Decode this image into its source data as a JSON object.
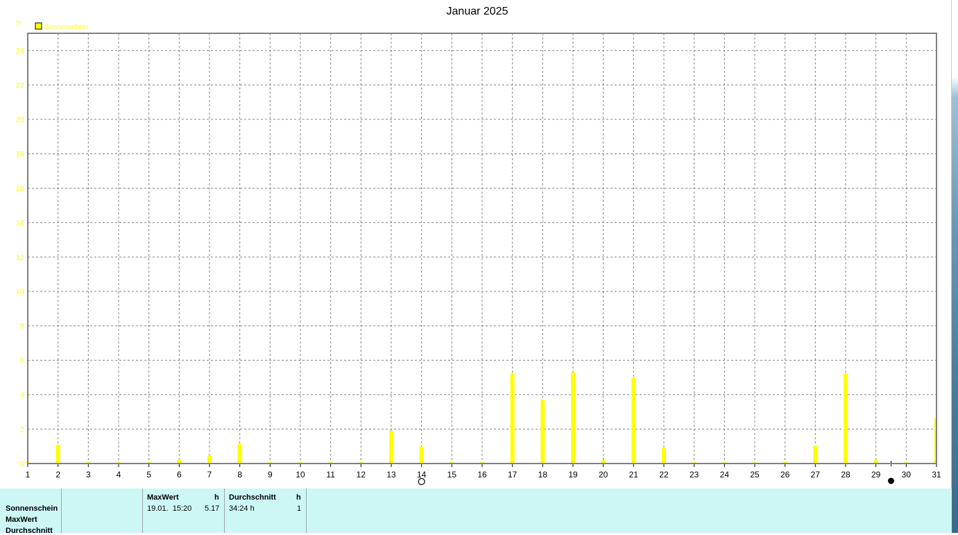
{
  "chart_data": {
    "type": "bar",
    "title": "Januar 2025",
    "ylabel": "h",
    "xlabel": "",
    "ylim": [
      0,
      25
    ],
    "yticks": [
      0,
      2,
      4,
      6,
      8,
      10,
      12,
      14,
      16,
      18,
      20,
      22,
      24
    ],
    "grid": true,
    "legend_position": "top-left",
    "categories": [
      "1",
      "2",
      "3",
      "4",
      "5",
      "6",
      "7",
      "8",
      "9",
      "10",
      "11",
      "12",
      "13",
      "14",
      "15",
      "16",
      "17",
      "18",
      "19",
      "20",
      "21",
      "22",
      "23",
      "24",
      "25",
      "26",
      "27",
      "28",
      "29",
      "30",
      "31"
    ],
    "series": [
      {
        "name": "Sonnenschein",
        "color": "#ffff00",
        "values": [
          0,
          1.1,
          0,
          0,
          0,
          0.25,
          0.5,
          1.15,
          0,
          0,
          0,
          0,
          1.9,
          1.0,
          0,
          0,
          5.25,
          3.7,
          5.3,
          0.2,
          5.0,
          0.9,
          0,
          0,
          0,
          0.1,
          1.05,
          5.25,
          0.2,
          0,
          2.65
        ]
      }
    ],
    "markers": [
      {
        "day": 14,
        "symbol": "full-moon-icon"
      },
      {
        "day": 29.5,
        "symbol": "new-moon-icon"
      }
    ]
  },
  "stats": {
    "row_labels": [
      "Sonnenschein",
      "MaxWert",
      "Durchschnitt"
    ],
    "maxwert": {
      "header": "MaxWert",
      "unit": "h",
      "datetime": "19.01.  15:20",
      "value": "5.17"
    },
    "durchschnitt": {
      "header": "Durchschnitt",
      "unit": "h",
      "value": "34:24 h",
      "count": "1"
    }
  }
}
